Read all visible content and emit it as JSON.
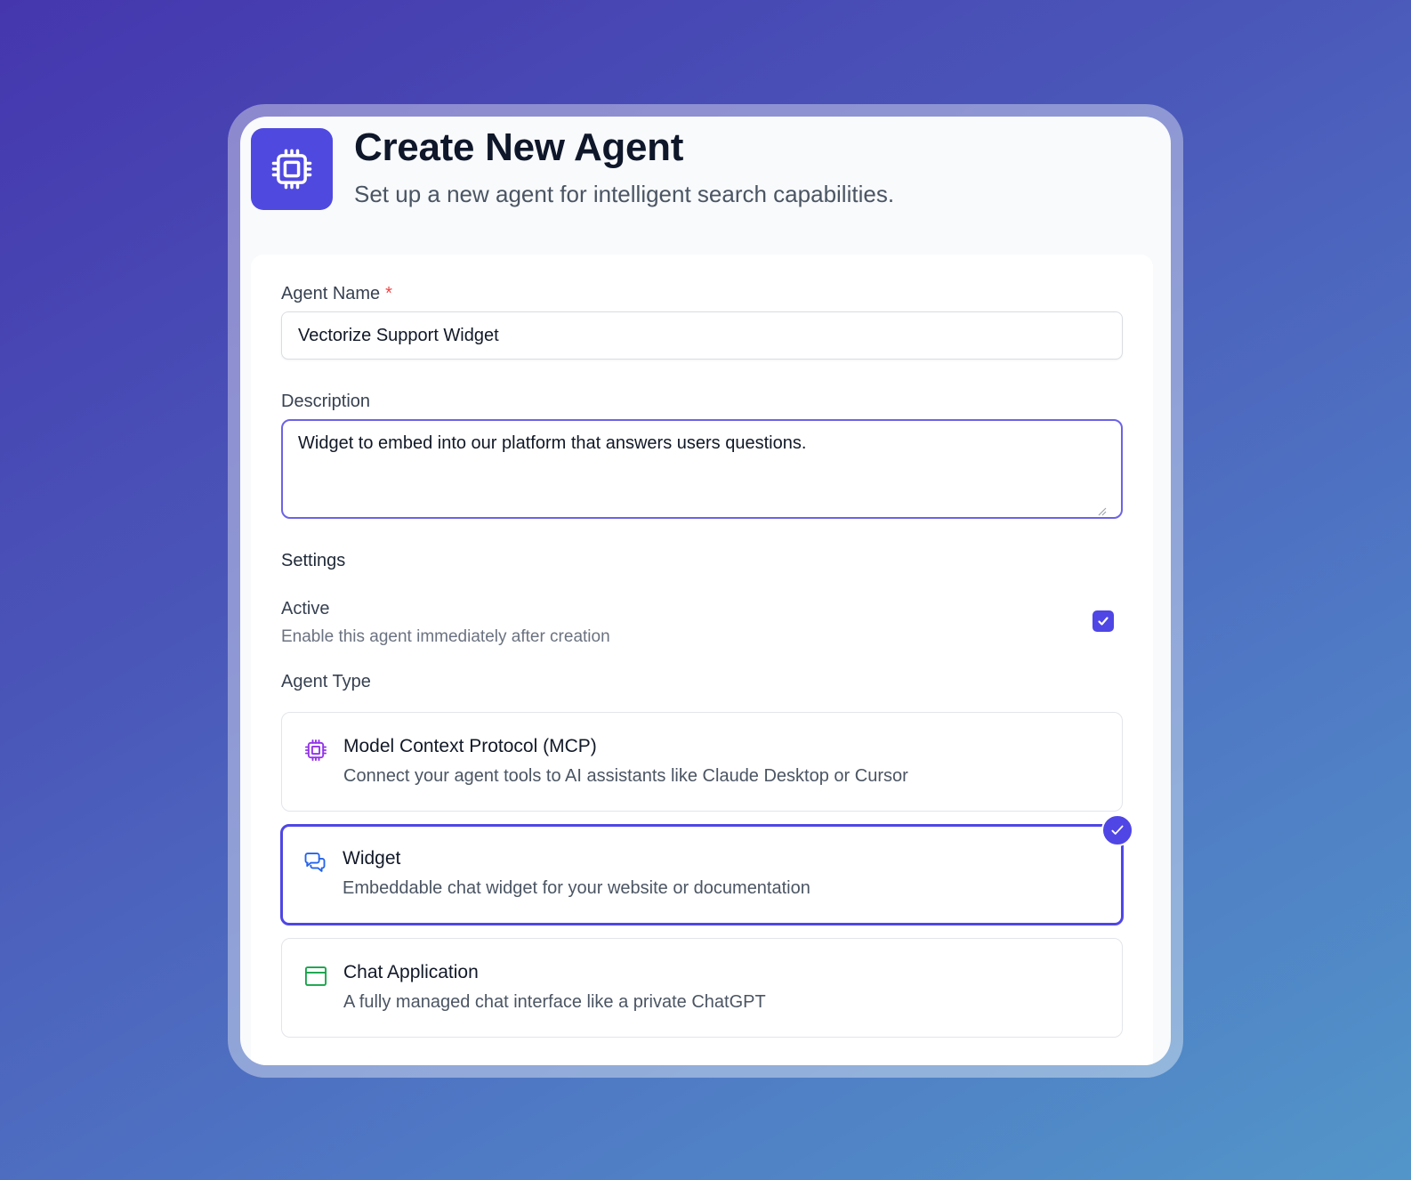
{
  "header": {
    "title": "Create New Agent",
    "subtitle": "Set up a new agent for intelligent search capabilities.",
    "logo_icon": "cpu-chip-icon"
  },
  "form": {
    "agent_name": {
      "label": "Agent Name",
      "required_mark": "*",
      "value": "Vectorize Support Widget"
    },
    "description": {
      "label": "Description",
      "value": "Widget to embed into our platform that answers users questions."
    },
    "settings": {
      "title": "Settings",
      "active": {
        "label": "Active",
        "description": "Enable this agent immediately after creation",
        "checked": true
      }
    },
    "agent_type": {
      "label": "Agent Type",
      "options": [
        {
          "title": "Model Context Protocol (MCP)",
          "description": "Connect your agent tools to AI assistants like Claude Desktop or Cursor",
          "icon": "cpu-chip-icon",
          "color": "#9333ea",
          "selected": false
        },
        {
          "title": "Widget",
          "description": "Embeddable chat widget for your website or documentation",
          "icon": "chat-bubbles-icon",
          "color": "#2563eb",
          "selected": true
        },
        {
          "title": "Chat Application",
          "description": "A fully managed chat interface like a private ChatGPT",
          "icon": "browser-window-icon",
          "color": "#16a34a",
          "selected": false
        }
      ]
    }
  },
  "colors": {
    "accent": "#4f46e5",
    "required": "#ef4444"
  }
}
